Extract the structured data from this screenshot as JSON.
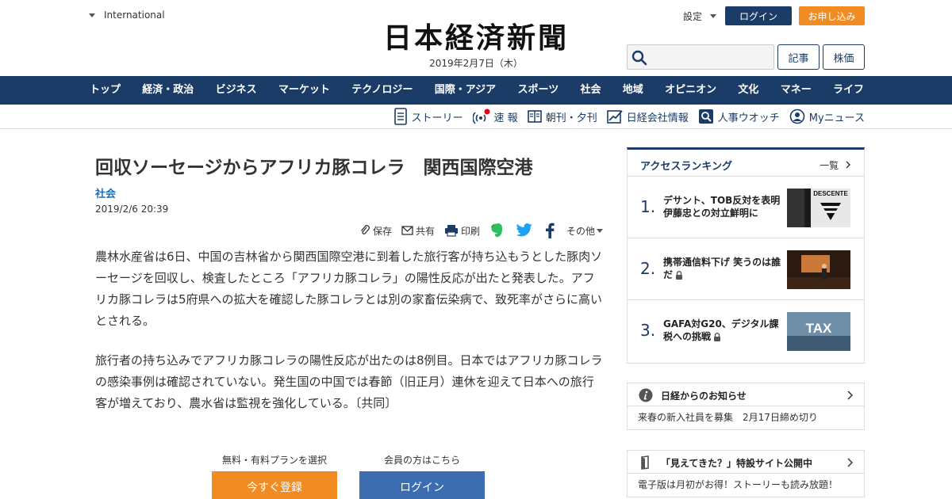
{
  "header": {
    "international_label": "International",
    "logo_text": "日本経済新聞",
    "date": "2019年2月7日（木）",
    "settings_label": "設定",
    "login_label": "ログイン",
    "apply_label": "お申し込み",
    "search_placeholder": "",
    "articles_label": "記事",
    "stocks_label": "株価"
  },
  "nav": {
    "items": [
      "トップ",
      "経済・政治",
      "ビジネス",
      "マーケット",
      "テクノロジー",
      "国際・アジア",
      "スポーツ",
      "社会",
      "地域",
      "オピニオン",
      "文化",
      "マネー",
      "ライフ"
    ]
  },
  "subnav": {
    "items": [
      "ストーリー",
      "速 報",
      "朝刊・夕刊",
      "日経会社情報",
      "人事ウオッチ",
      "Myニュース"
    ]
  },
  "article": {
    "title": "回収ソーセージからアフリカ豚コレラ　関西国際空港",
    "section": "社会",
    "date": "2019/2/6 20:39",
    "share": {
      "save": "保存",
      "share": "共有",
      "print": "印刷",
      "more": "その他"
    },
    "paragraphs": [
      "農林水産省は6日、中国の吉林省から関西国際空港に到着した旅行客が持ち込もうとした豚肉ソーセージを回収し、検査したところ「アフリカ豚コレラ」の陽性反応が出たと発表した。アフリカ豚コレラは5府県への拡大を確認した豚コレラとは別の家畜伝染病で、致死率がさらに高いとされる。",
      "旅行者の持ち込みでアフリカ豚コレラの陽性反応が出たのは8例目。日本ではアフリカ豚コレラの感染事例は確認されていない。発生国の中国では春節（旧正月）連休を迎えて日本への旅行客が増えており、農水省は監視を強化している。〔共同〕"
    ],
    "cta": {
      "register_caption": "無料・有料プランを選択",
      "register_label": "今すぐ登録",
      "login_caption": "会員の方はこちら",
      "login_label": "ログイン"
    }
  },
  "ranking": {
    "title": "アクセスランキング",
    "more_label": "一覧",
    "items": [
      {
        "rank": "1.",
        "text": "デサント、TOB反対を表明　伊藤忠との対立鮮明に",
        "thumb_text": "DESCENTE"
      },
      {
        "rank": "2.",
        "text": "携帯通信料下げ 笑うのは誰だ",
        "thumb_text": ""
      },
      {
        "rank": "3.",
        "text": "GAFA対G20、デジタル課税への挑戦",
        "thumb_text": "TAX"
      }
    ]
  },
  "notices": [
    {
      "title": "日経からのお知らせ",
      "body": "来春の新入社員を募集　2月17日締め切り"
    },
    {
      "title": "「見えてきた？」特設サイト公開中",
      "body": "電子版は月初がお得！ストーリーも読み放題！"
    }
  ],
  "colors": {
    "navy": "#1a3c67",
    "orange": "#f08c22",
    "link_blue": "#1f6eb5",
    "login_blue": "#3b6db0"
  }
}
